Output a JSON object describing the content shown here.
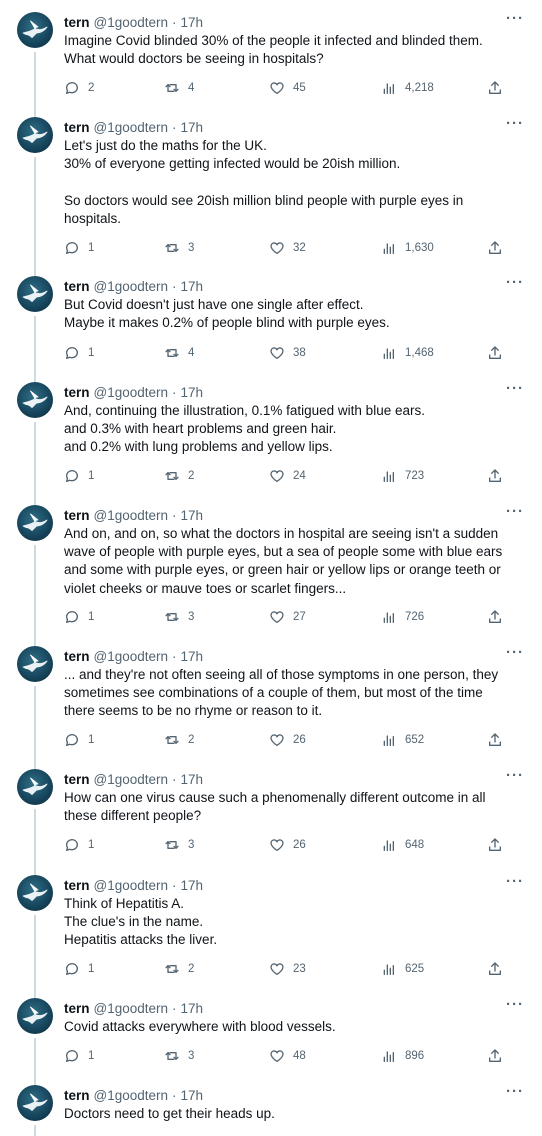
{
  "author": {
    "name": "tern",
    "handle": "@1goodtern",
    "time": "17h"
  },
  "more_label": "···",
  "tweets": [
    {
      "lines": [
        "Imagine Covid blinded 30% of the people it infected and blinded them.",
        "What would doctors be seeing in hospitals?"
      ],
      "replies": "2",
      "retweets": "4",
      "likes": "45",
      "views": "4,218"
    },
    {
      "lines": [
        "Let's just do the maths for the UK.",
        "30% of everyone getting infected would be 20ish million.",
        "",
        "So doctors would see 20ish million blind people with purple eyes in",
        "hospitals."
      ],
      "replies": "1",
      "retweets": "3",
      "likes": "32",
      "views": "1,630"
    },
    {
      "lines": [
        "But Covid doesn't just have one single after effect.",
        "Maybe it makes 0.2% of people blind with purple eyes."
      ],
      "replies": "1",
      "retweets": "4",
      "likes": "38",
      "views": "1,468"
    },
    {
      "lines": [
        "And, continuing the illustration, 0.1% fatigued with blue ears.",
        "and 0.3% with heart problems and green hair.",
        "and 0.2% with lung problems and yellow lips."
      ],
      "replies": "1",
      "retweets": "2",
      "likes": "24",
      "views": "723"
    },
    {
      "lines": [
        "And on, and on, so what the doctors in hospital are seeing isn't a sudden",
        "wave of people with purple eyes, but a sea of people some with blue ears",
        "and some with purple eyes, or green hair or yellow lips or orange teeth or",
        "violet cheeks or mauve toes or scarlet fingers..."
      ],
      "replies": "1",
      "retweets": "3",
      "likes": "27",
      "views": "726"
    },
    {
      "lines": [
        "... and they're not often seeing all of those symptoms in one person, they",
        "sometimes see combinations of a couple of them, but most of the time",
        "there seems to be no rhyme or reason to it."
      ],
      "replies": "1",
      "retweets": "2",
      "likes": "26",
      "views": "652"
    },
    {
      "lines": [
        "How can one virus cause such a phenomenally different outcome in all",
        "these different people?"
      ],
      "replies": "1",
      "retweets": "3",
      "likes": "26",
      "views": "648"
    },
    {
      "lines": [
        "Think of Hepatitis A.",
        "The clue's in the name.",
        "Hepatitis attacks the liver."
      ],
      "replies": "1",
      "retweets": "2",
      "likes": "23",
      "views": "625"
    },
    {
      "lines": [
        "Covid attacks everywhere with blood vessels."
      ],
      "replies": "1",
      "retweets": "3",
      "likes": "48",
      "views": "896"
    },
    {
      "lines": [
        "Doctors need to get their heads up."
      ]
    }
  ]
}
